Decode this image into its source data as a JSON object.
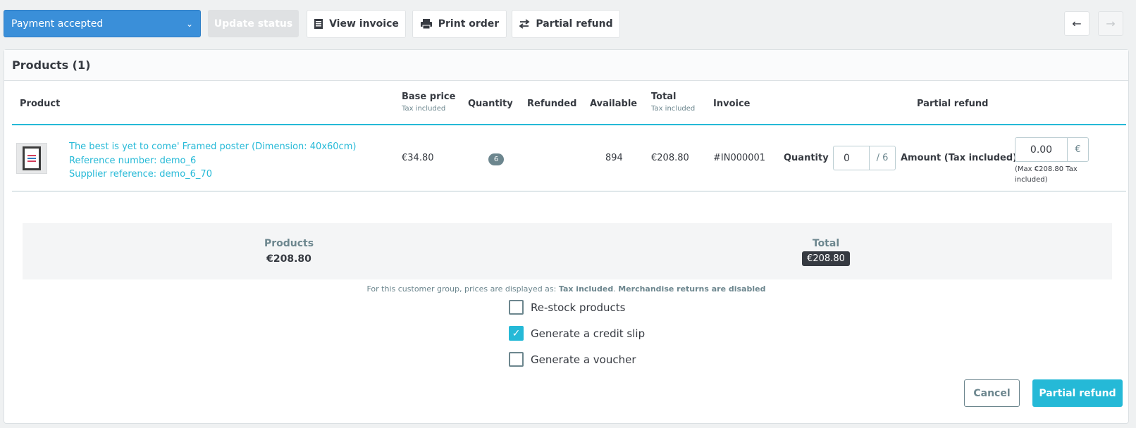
{
  "toolbar": {
    "status_select": "Payment accepted",
    "update_status": "Update status",
    "view_invoice": "View invoice",
    "print_order": "Print order",
    "partial_refund": "Partial refund"
  },
  "card": {
    "title": "Products (1)",
    "columns": {
      "product": "Product",
      "base_price": "Base price",
      "base_price_sub": "Tax included",
      "quantity": "Quantity",
      "refunded": "Refunded",
      "available": "Available",
      "total": "Total",
      "total_sub": "Tax included",
      "invoice": "Invoice",
      "partial_refund": "Partial refund"
    },
    "row": {
      "name": "The best is yet to come' Framed poster (Dimension: 40x60cm)",
      "reference": "Reference number: demo_6",
      "supplier_reference": "Supplier reference: demo_6_70",
      "base_price": "€34.80",
      "quantity": "6",
      "refunded": "",
      "available": "894",
      "total": "€208.80",
      "invoice": "#IN000001",
      "refund_quantity_label": "Quantity",
      "refund_quantity_value": "0",
      "refund_quantity_max": "/ 6",
      "refund_amount_label": "Amount (Tax included)",
      "refund_amount_value": "0.00",
      "refund_amount_currency": "€",
      "refund_amount_note": "(Max €208.80 Tax included)"
    }
  },
  "summary": {
    "products_label": "Products",
    "products_value": "€208.80",
    "total_label": "Total",
    "total_value": "€208.80"
  },
  "tax_note": {
    "prefix": "For this customer group, prices are displayed as: ",
    "tax_mode": "Tax included",
    "separator": ". ",
    "returns": "Merchandise returns are disabled"
  },
  "options": {
    "restock": "Re-stock products",
    "credit_slip": "Generate a credit slip",
    "voucher": "Generate a voucher"
  },
  "actions": {
    "cancel": "Cancel",
    "partial_refund": "Partial refund"
  },
  "colors": {
    "accent": "#25b9d7",
    "status_blue": "#3a8fd9"
  }
}
